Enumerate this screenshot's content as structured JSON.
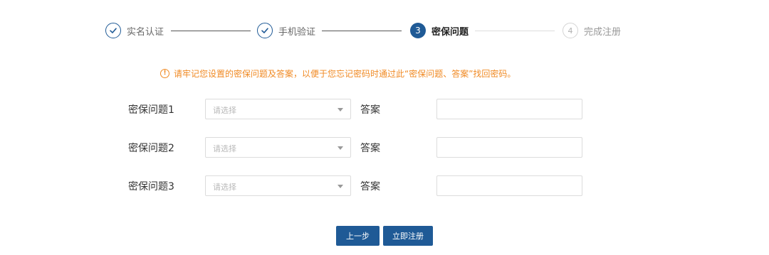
{
  "steps": [
    {
      "label": "实名认证",
      "state": "done"
    },
    {
      "label": "手机验证",
      "state": "done"
    },
    {
      "number": "3",
      "label": "密保问题",
      "state": "active"
    },
    {
      "number": "4",
      "label": "完成注册",
      "state": "todo"
    }
  ],
  "notice": {
    "icon": "exclamation-circle-icon",
    "text": "请牢记您设置的密保问题及答案，以便于您忘记密码时通过此“密保问题、答案”找回密码。",
    "color": "#f08a24"
  },
  "questions": [
    {
      "label": "密保问题1",
      "select_placeholder": "请选择",
      "answer_label": "答案",
      "answer_value": ""
    },
    {
      "label": "密保问题2",
      "select_placeholder": "请选择",
      "answer_label": "答案",
      "answer_value": ""
    },
    {
      "label": "密保问题3",
      "select_placeholder": "请选择",
      "answer_label": "答案",
      "answer_value": ""
    }
  ],
  "buttons": {
    "prev": "上一步",
    "register": "立即注册"
  },
  "colors": {
    "primary": "#1f5a96",
    "warning": "#f08a24"
  }
}
